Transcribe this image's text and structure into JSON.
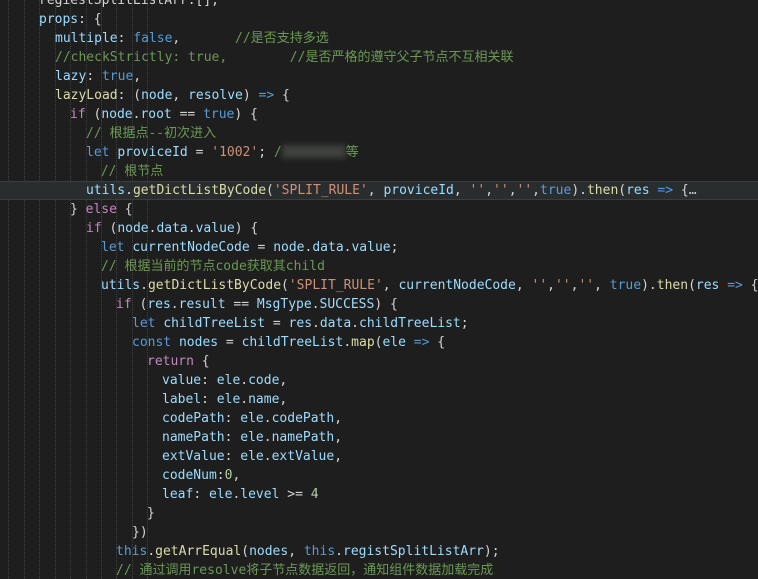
{
  "editor": {
    "lines": [
      [
        [
          "pl",
          "regiestSplitListArr:[],"
        ]
      ],
      [
        [
          "var",
          "props"
        ],
        [
          "pl",
          ": {"
        ]
      ],
      [
        [
          "var",
          "multiple"
        ],
        [
          "pl",
          ": "
        ],
        [
          "kw",
          "false"
        ],
        [
          "pl",
          ",       "
        ],
        [
          "cmt",
          "//是否支持多选"
        ]
      ],
      [
        [
          "cmt",
          "//checkStrictly: true,        //是否严格的遵守父子节点不互相关联"
        ]
      ],
      [
        [
          "var",
          "lazy"
        ],
        [
          "pl",
          ": "
        ],
        [
          "kw",
          "true"
        ],
        [
          "pl",
          ","
        ]
      ],
      [
        [
          "fn",
          "lazyLoad"
        ],
        [
          "pl",
          ": ("
        ],
        [
          "var",
          "node"
        ],
        [
          "pl",
          ", "
        ],
        [
          "var",
          "resolve"
        ],
        [
          "pl",
          ") "
        ],
        [
          "kw",
          "=>"
        ],
        [
          "pl",
          " {"
        ]
      ],
      [
        [
          "ctl",
          "if"
        ],
        [
          "pl",
          " ("
        ],
        [
          "var",
          "node"
        ],
        [
          "pl",
          "."
        ],
        [
          "var",
          "root"
        ],
        [
          "pl",
          " == "
        ],
        [
          "kw",
          "true"
        ],
        [
          "pl",
          ") {"
        ]
      ],
      [
        [
          "cmt",
          "// 根据点--初次进入"
        ]
      ],
      [
        [
          "kw",
          "let"
        ],
        [
          "pl",
          " "
        ],
        [
          "var",
          "proviceId"
        ],
        [
          "pl",
          " = "
        ],
        [
          "str",
          "'1002'"
        ],
        [
          "pl",
          "; "
        ],
        [
          "cmt",
          "/"
        ],
        [
          "blur",
          ""
        ],
        [
          "cmt",
          "等"
        ]
      ],
      [
        [
          "cmt",
          " // 根节点"
        ]
      ],
      [
        [
          "var",
          "utils"
        ],
        [
          "pl",
          "."
        ],
        [
          "fn",
          "getDictListByCode"
        ],
        [
          "pl",
          "("
        ],
        [
          "str",
          "'SPLIT_RULE'"
        ],
        [
          "pl",
          ", "
        ],
        [
          "var",
          "proviceId"
        ],
        [
          "pl",
          ", "
        ],
        [
          "str",
          "''"
        ],
        [
          "pl",
          ","
        ],
        [
          "str",
          "''"
        ],
        [
          "pl",
          ","
        ],
        [
          "str",
          "''"
        ],
        [
          "pl",
          ","
        ],
        [
          "kw",
          "true"
        ],
        [
          "pl",
          ")."
        ],
        [
          "fn",
          "then"
        ],
        [
          "pl",
          "("
        ],
        [
          "var",
          "res"
        ],
        [
          "pl",
          " "
        ],
        [
          "kw",
          "=>"
        ],
        [
          "pl",
          " {"
        ],
        [
          "ellipsis",
          "…"
        ]
      ],
      [
        [
          "pl",
          "} "
        ],
        [
          "ctl",
          "else"
        ],
        [
          "pl",
          " {"
        ]
      ],
      [
        [
          "ctl",
          "if"
        ],
        [
          "pl",
          " ("
        ],
        [
          "var",
          "node"
        ],
        [
          "pl",
          "."
        ],
        [
          "var",
          "data"
        ],
        [
          "pl",
          "."
        ],
        [
          "var",
          "value"
        ],
        [
          "pl",
          ") {"
        ]
      ],
      [
        [
          "kw",
          "let"
        ],
        [
          "pl",
          " "
        ],
        [
          "var",
          "currentNodeCode"
        ],
        [
          "pl",
          " = "
        ],
        [
          "var",
          "node"
        ],
        [
          "pl",
          "."
        ],
        [
          "var",
          "data"
        ],
        [
          "pl",
          "."
        ],
        [
          "var",
          "value"
        ],
        [
          "pl",
          ";"
        ]
      ],
      [
        [
          "cmt",
          "// 根据当前的节点code获取其child"
        ]
      ],
      [
        [
          "var",
          "utils"
        ],
        [
          "pl",
          "."
        ],
        [
          "fn",
          "getDictListByCode"
        ],
        [
          "pl",
          "("
        ],
        [
          "str",
          "'SPLIT_RULE'"
        ],
        [
          "pl",
          ", "
        ],
        [
          "var",
          "currentNodeCode"
        ],
        [
          "pl",
          ", "
        ],
        [
          "str",
          "''"
        ],
        [
          "pl",
          ","
        ],
        [
          "str",
          "''"
        ],
        [
          "pl",
          ","
        ],
        [
          "str",
          "''"
        ],
        [
          "pl",
          ", "
        ],
        [
          "kw",
          "true"
        ],
        [
          "pl",
          ")."
        ],
        [
          "fn",
          "then"
        ],
        [
          "pl",
          "("
        ],
        [
          "var",
          "res"
        ],
        [
          "pl",
          " "
        ],
        [
          "kw",
          "=>"
        ],
        [
          "pl",
          " {"
        ]
      ],
      [
        [
          "ctl",
          "if"
        ],
        [
          "pl",
          " ("
        ],
        [
          "var",
          "res"
        ],
        [
          "pl",
          "."
        ],
        [
          "var",
          "result"
        ],
        [
          "pl",
          " == "
        ],
        [
          "var",
          "MsgType"
        ],
        [
          "pl",
          "."
        ],
        [
          "var",
          "SUCCESS"
        ],
        [
          "pl",
          ") {"
        ]
      ],
      [
        [
          "kw",
          "let"
        ],
        [
          "pl",
          " "
        ],
        [
          "var",
          "childTreeList"
        ],
        [
          "pl",
          " = "
        ],
        [
          "var",
          "res"
        ],
        [
          "pl",
          "."
        ],
        [
          "var",
          "data"
        ],
        [
          "pl",
          "."
        ],
        [
          "var",
          "childTreeList"
        ],
        [
          "pl",
          ";"
        ]
      ],
      [
        [
          "kw",
          "const"
        ],
        [
          "pl",
          " "
        ],
        [
          "var",
          "nodes"
        ],
        [
          "pl",
          " = "
        ],
        [
          "var",
          "childTreeList"
        ],
        [
          "pl",
          "."
        ],
        [
          "fn",
          "map"
        ],
        [
          "pl",
          "("
        ],
        [
          "var",
          "ele"
        ],
        [
          "pl",
          " "
        ],
        [
          "kw",
          "=>"
        ],
        [
          "pl",
          " {"
        ]
      ],
      [
        [
          "ctl",
          "return"
        ],
        [
          "pl",
          " {"
        ]
      ],
      [
        [
          "var",
          "value"
        ],
        [
          "pl",
          ": "
        ],
        [
          "var",
          "ele"
        ],
        [
          "pl",
          "."
        ],
        [
          "var",
          "code"
        ],
        [
          "pl",
          ","
        ]
      ],
      [
        [
          "var",
          "label"
        ],
        [
          "pl",
          ": "
        ],
        [
          "var",
          "ele"
        ],
        [
          "pl",
          "."
        ],
        [
          "var",
          "name"
        ],
        [
          "pl",
          ","
        ]
      ],
      [
        [
          "var",
          "codePath"
        ],
        [
          "pl",
          ": "
        ],
        [
          "var",
          "ele"
        ],
        [
          "pl",
          "."
        ],
        [
          "var",
          "codePath"
        ],
        [
          "pl",
          ","
        ]
      ],
      [
        [
          "var",
          "namePath"
        ],
        [
          "pl",
          ": "
        ],
        [
          "var",
          "ele"
        ],
        [
          "pl",
          "."
        ],
        [
          "var",
          "namePath"
        ],
        [
          "pl",
          ","
        ]
      ],
      [
        [
          "var",
          "extValue"
        ],
        [
          "pl",
          ": "
        ],
        [
          "var",
          "ele"
        ],
        [
          "pl",
          "."
        ],
        [
          "var",
          "extValue"
        ],
        [
          "pl",
          ","
        ]
      ],
      [
        [
          "var",
          "codeNum"
        ],
        [
          "pl",
          ":"
        ],
        [
          "num",
          "0"
        ],
        [
          "pl",
          ","
        ]
      ],
      [
        [
          "var",
          "leaf"
        ],
        [
          "pl",
          ": "
        ],
        [
          "var",
          "ele"
        ],
        [
          "pl",
          "."
        ],
        [
          "var",
          "level"
        ],
        [
          "pl",
          " >= "
        ],
        [
          "num",
          "4"
        ]
      ],
      [
        [
          "pl",
          "}"
        ]
      ],
      [
        [
          "pl",
          "})"
        ]
      ],
      [
        [
          "kw",
          "this"
        ],
        [
          "pl",
          "."
        ],
        [
          "fn",
          "getArrEqual"
        ],
        [
          "pl",
          "("
        ],
        [
          "var",
          "nodes"
        ],
        [
          "pl",
          ", "
        ],
        [
          "kw",
          "this"
        ],
        [
          "pl",
          "."
        ],
        [
          "var",
          "registSplitListArr"
        ],
        [
          "pl",
          ");"
        ]
      ],
      [
        [
          "cmt",
          "// 通过调用resolve将子节点数据返回，通知组件数据加载完成"
        ]
      ]
    ]
  }
}
